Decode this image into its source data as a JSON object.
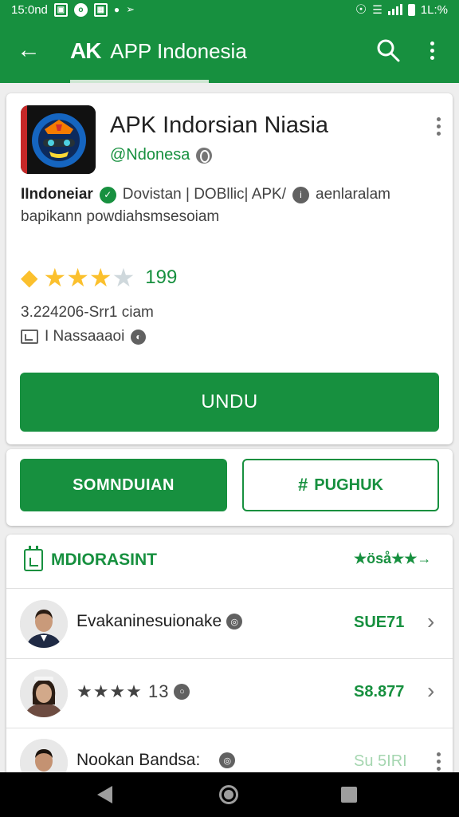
{
  "status_bar": {
    "time": "15:0nd",
    "icons_left": [
      "image-icon",
      "circle-icon",
      "calendar-icon",
      "cloud-icon",
      "wifi-arrow-icon"
    ],
    "battery": "1L:%"
  },
  "app_bar": {
    "logo": "AK",
    "title": "APP Indonesia",
    "back_icon": "arrow-left-icon",
    "search_icon": "search-icon",
    "menu_icon": "more-vertical-icon"
  },
  "app_card": {
    "name": "APK Indorsian Niasia",
    "developer": "@Ndonesa",
    "desc_strong": "IIndoneiar",
    "desc_mid": "Dovistan | DOBllic| APK/",
    "desc_end": "aenlaralam",
    "desc_line2": "bapikann powdiahsmsesoiam",
    "rating_count": "199",
    "stars_filled": 3,
    "stars_total": 4,
    "meta_line1": "3.224206-Srr1 ciam",
    "meta_line2": "I Nassaaaoi",
    "install_label": "UNDU"
  },
  "actions": {
    "primary_label": "SOMNDUIAN",
    "secondary_label": "PUGHUK",
    "secondary_icon": "hash-icon"
  },
  "related": {
    "header": "MDIORASINT",
    "see_all": "★öså★★→",
    "items": [
      {
        "title": "Evakaninesuionake",
        "value": "SUE71"
      },
      {
        "stars": "★★★★ 13",
        "value": "S8.877"
      },
      {
        "title": "Nookan Bandsa:",
        "value": "Su 5IRI"
      }
    ]
  },
  "colors": {
    "brand_green": "#17903f",
    "star_yellow": "#fbc02d"
  }
}
